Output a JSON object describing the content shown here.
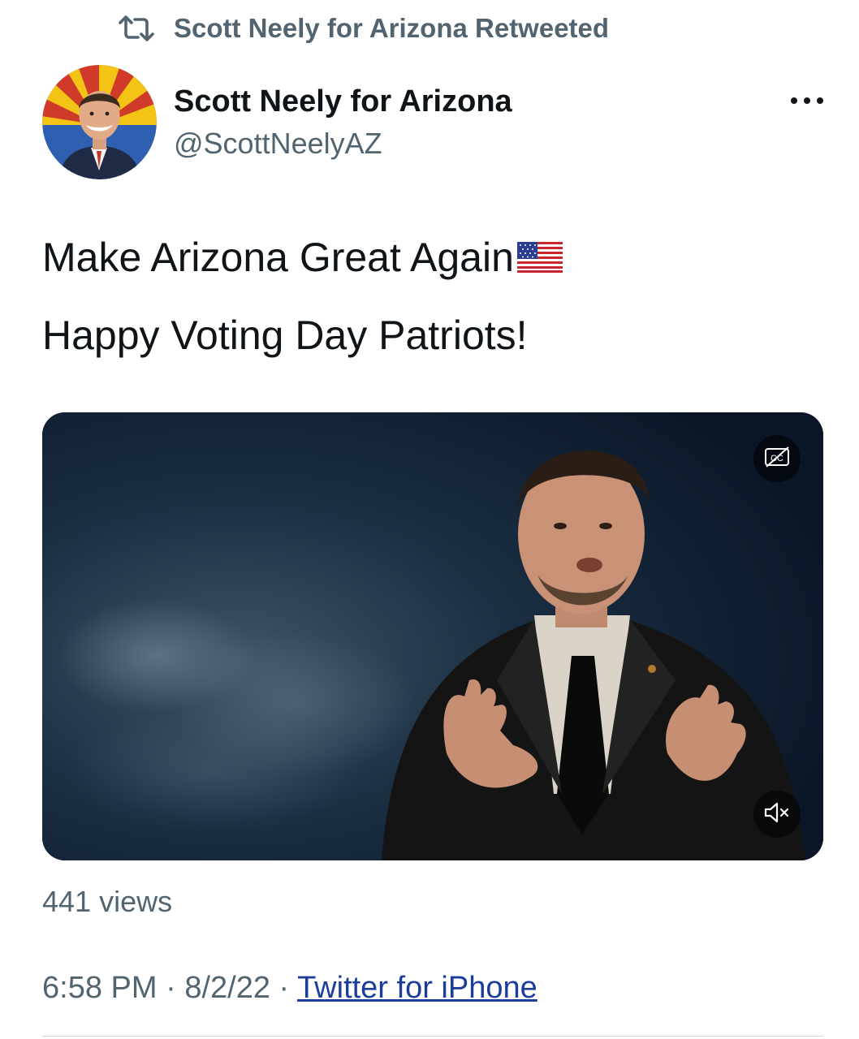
{
  "retweet": {
    "icon": "retweet-icon",
    "text": "Scott Neely for Arizona Retweeted"
  },
  "author": {
    "name": "Scott Neely for Arizona",
    "handle": "@ScottNeelyAZ",
    "avatar": "avatar-photo"
  },
  "more_icon": "more-dots-icon",
  "tweet": {
    "line1": "Make Arizona Great Again",
    "emoji": "🇺🇸",
    "line2": "Happy Voting Day Patriots!"
  },
  "media": {
    "type": "video",
    "captions_icon": "closed-captions-icon",
    "mute_icon": "speaker-muted-icon"
  },
  "stats": {
    "views": "441 views"
  },
  "meta": {
    "time": "6:58 PM",
    "separator": "·",
    "date": "8/2/22",
    "source": "Twitter for iPhone"
  },
  "colors": {
    "text_primary": "#0f1419",
    "text_secondary": "#536471",
    "link": "#1d3d9b",
    "divider": "#cfd9de"
  }
}
